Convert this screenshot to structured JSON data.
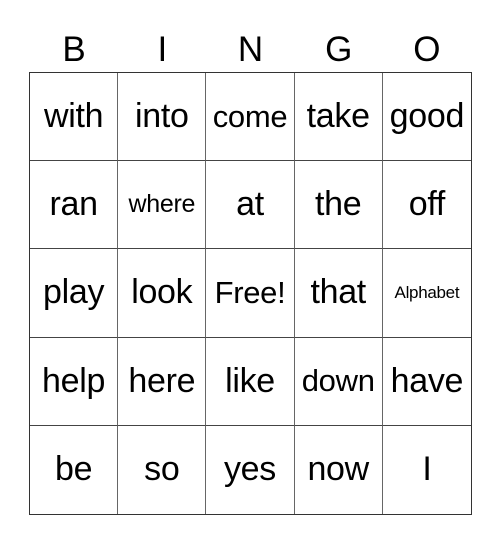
{
  "header": {
    "letters": [
      "B",
      "I",
      "N",
      "G",
      "O"
    ]
  },
  "card": {
    "rows": [
      [
        "with",
        "into",
        "come",
        "take",
        "good"
      ],
      [
        "ran",
        "where",
        "at",
        "the",
        "off"
      ],
      [
        "play",
        "look",
        "Free!",
        "that",
        "Alphabet"
      ],
      [
        "help",
        "here",
        "like",
        "down",
        "have"
      ],
      [
        "be",
        "so",
        "yes",
        "now",
        "I"
      ]
    ]
  }
}
